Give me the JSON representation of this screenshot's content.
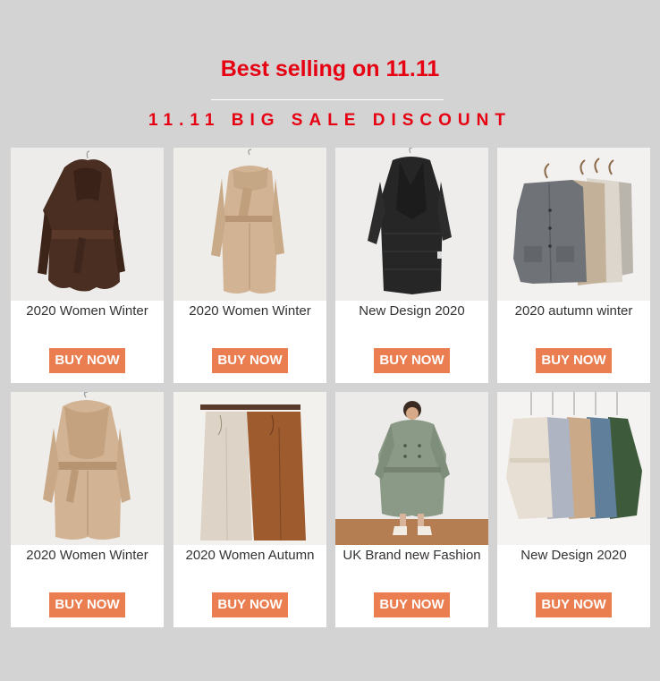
{
  "header": {
    "title": "Best selling on 11.11",
    "subtitle": "11.11 BIG SALE DISCOUNT"
  },
  "colors": {
    "accent_red": "#e60012",
    "button_orange": "#ea7e50",
    "page_bg": "#d3d3d3"
  },
  "products": [
    {
      "name": "2020 Women Winter",
      "button": "BUY NOW",
      "image": "brown-hooded-puffer-coat"
    },
    {
      "name": "2020 Women Winter",
      "button": "BUY NOW",
      "image": "beige-scarf-puffer-coat"
    },
    {
      "name": "New Design 2020",
      "button": "BUY NOW",
      "image": "black-quilted-long-coat"
    },
    {
      "name": "2020 autumn winter",
      "button": "BUY NOW",
      "image": "knit-cardigans-on-hangers"
    },
    {
      "name": "2020 Women Winter",
      "button": "BUY NOW",
      "image": "khaki-shawl-collar-puffer-coat"
    },
    {
      "name": "2020 Women Autumn",
      "button": "BUY NOW",
      "image": "wide-leg-knit-pants"
    },
    {
      "name": "UK Brand new Fashion",
      "button": "BUY NOW",
      "image": "green-trench-coat-model"
    },
    {
      "name": "New Design 2020",
      "button": "BUY NOW",
      "image": "quilted-coats-color-range"
    }
  ]
}
